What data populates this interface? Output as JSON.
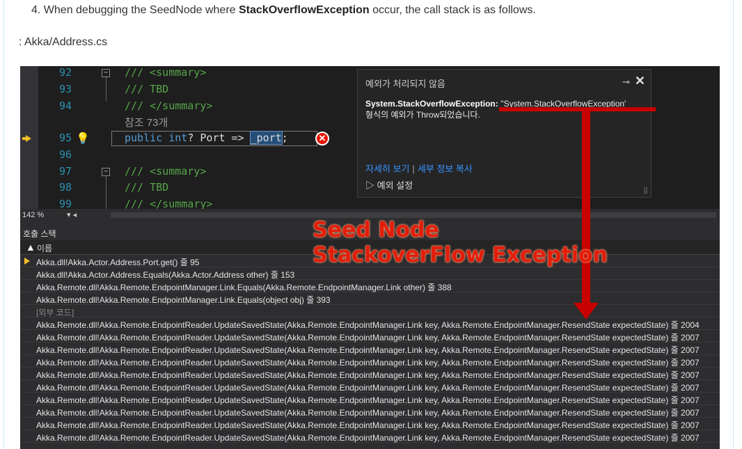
{
  "instruction": {
    "prefix": "4. When debugging the SeedNode where ",
    "emph": "StackOverflowException",
    "suffix": " occur, the call stack is as follows."
  },
  "file_label": ": Akka/Address.cs",
  "editor": {
    "lines": [
      {
        "num": "92",
        "text": "/// <summary>"
      },
      {
        "num": "93",
        "text": "/// TBD"
      },
      {
        "num": "94",
        "text": "/// </summary>"
      },
      {
        "num": "95",
        "kw1": "public",
        "kw2": "int",
        "rest": "? Port => ",
        "sel": "_port",
        "end": ";"
      },
      {
        "num": "96",
        "text": ""
      },
      {
        "num": "97",
        "text": "/// <summary>"
      },
      {
        "num": "98",
        "text": "/// TBD"
      },
      {
        "num": "99",
        "text": "/// </summary>"
      }
    ],
    "refs": "참조 73개",
    "zoom": "142 %"
  },
  "popup": {
    "title": "예외가 처리되지 않음",
    "pin": "⊸",
    "close": "✕",
    "ex_type": "System.StackOverflowException:",
    "ex_quote": " ''System.StackOverflowException'",
    "ex_line2": "형식의 예외가 Throw되었습니다.",
    "link_details": "자세히 보기",
    "link_copy": "세부 정보 복사",
    "settings": "▷ 예외 설정"
  },
  "callstack": {
    "title": "호출 스택",
    "col_name": "이름",
    "rows": [
      {
        "text": "Akka.dll!Akka.Actor.Address.Port.get() 줄 95",
        "current": true
      },
      {
        "text": "Akka.dll!Akka.Actor.Address.Equals(Akka.Actor.Address other) 줄 153"
      },
      {
        "text": "Akka.Remote.dll!Akka.Remote.EndpointManager.Link.Equals(Akka.Remote.EndpointManager.Link other) 줄 388"
      },
      {
        "text": "Akka.Remote.dll!Akka.Remote.EndpointManager.Link.Equals(object obj) 줄 393"
      },
      {
        "text": "[외부 코드]",
        "external": true
      },
      {
        "text": "Akka.Remote.dll!Akka.Remote.EndpointReader.UpdateSavedState(Akka.Remote.EndpointManager.Link key, Akka.Remote.EndpointManager.ResendState expectedState) 줄 2004"
      },
      {
        "text": "Akka.Remote.dll!Akka.Remote.EndpointReader.UpdateSavedState(Akka.Remote.EndpointManager.Link key, Akka.Remote.EndpointManager.ResendState expectedState) 줄 2007"
      },
      {
        "text": "Akka.Remote.dll!Akka.Remote.EndpointReader.UpdateSavedState(Akka.Remote.EndpointManager.Link key, Akka.Remote.EndpointManager.ResendState expectedState) 줄 2007"
      },
      {
        "text": "Akka.Remote.dll!Akka.Remote.EndpointReader.UpdateSavedState(Akka.Remote.EndpointManager.Link key, Akka.Remote.EndpointManager.ResendState expectedState) 줄 2007"
      },
      {
        "text": "Akka.Remote.dll!Akka.Remote.EndpointReader.UpdateSavedState(Akka.Remote.EndpointManager.Link key, Akka.Remote.EndpointManager.ResendState expectedState) 줄 2007"
      },
      {
        "text": "Akka.Remote.dll!Akka.Remote.EndpointReader.UpdateSavedState(Akka.Remote.EndpointManager.Link key, Akka.Remote.EndpointManager.ResendState expectedState) 줄 2007"
      },
      {
        "text": "Akka.Remote.dll!Akka.Remote.EndpointReader.UpdateSavedState(Akka.Remote.EndpointManager.Link key, Akka.Remote.EndpointManager.ResendState expectedState) 줄 2007"
      },
      {
        "text": "Akka.Remote.dll!Akka.Remote.EndpointReader.UpdateSavedState(Akka.Remote.EndpointManager.Link key, Akka.Remote.EndpointManager.ResendState expectedState) 줄 2007"
      },
      {
        "text": "Akka.Remote.dll!Akka.Remote.EndpointReader.UpdateSavedState(Akka.Remote.EndpointManager.Link key, Akka.Remote.EndpointManager.ResendState expectedState) 줄 2007"
      },
      {
        "text": "Akka.Remote.dll!Akka.Remote.EndpointReader.UpdateSavedState(Akka.Remote.EndpointManager.Link key, Akka.Remote.EndpointManager.ResendState expectedState) 줄 2007"
      }
    ]
  },
  "annotation": {
    "line1": "Seed Node",
    "line2": "StackoverFlow Exception",
    "color": "#c80000"
  }
}
